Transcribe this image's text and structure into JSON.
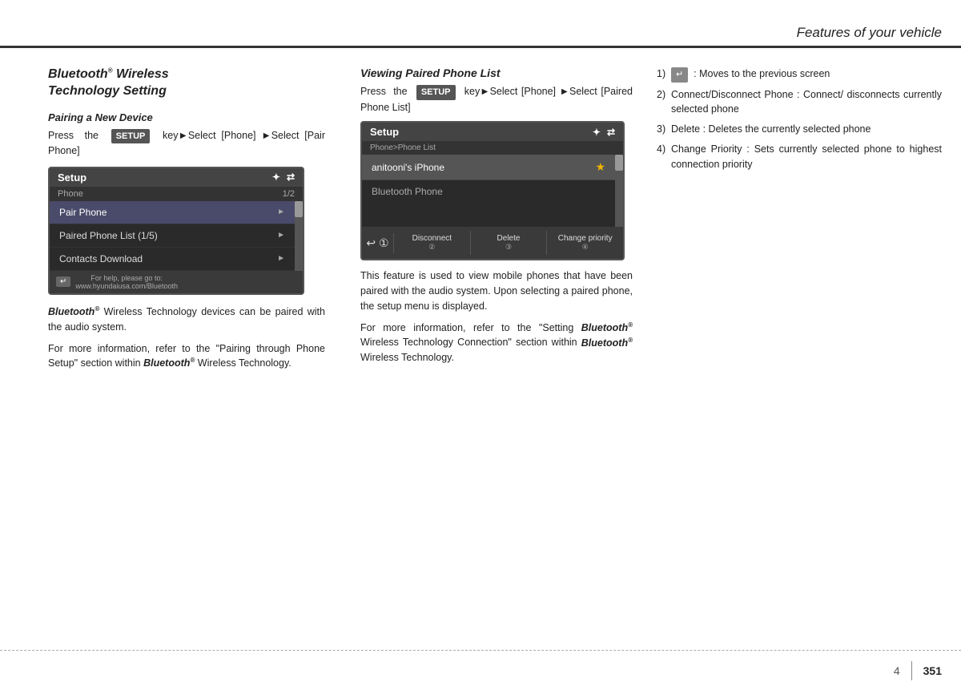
{
  "header": {
    "title": "Features of your vehicle"
  },
  "left_col": {
    "main_title_line1": "Bluetooth",
    "main_title_line2": "® Wireless",
    "main_title_line3": "Technology Setting",
    "pairing_heading": "Pairing a New Device",
    "pairing_text": "Press  the",
    "pairing_badge": "SETUP",
    "pairing_text2": "key▶Select [Phone] ▶Select [Pair Phone]",
    "device_header": "Setup",
    "device_bt_icon": "✦",
    "device_arrow_icon": "⇄",
    "device_subheader": "Phone",
    "device_page": "1/2",
    "menu_item_1": "Pair Phone",
    "menu_item_2": "Paired Phone List (1/5)",
    "menu_item_3": "Contacts Download",
    "device_footer_text": "For help, please go to:",
    "device_footer_url": "www.hyundaiusa.com/Bluetooth",
    "below_text_1": "Bluetooth® Wireless Technology devices can be paired with the audio system.",
    "below_text_2": "For more information, refer to the \"Pairing through Phone Setup\" section within Bluetooth® Wireless Technology."
  },
  "mid_col": {
    "viewing_title": "Viewing Paired Phone List",
    "viewing_text1": "Press  the",
    "viewing_badge": "SETUP",
    "viewing_text2": "key▶Select [Phone] ▶Select [Paired Phone List]",
    "device_header": "Setup",
    "device_bt_icon": "✦",
    "device_arrow_icon": "⇄",
    "device_subheader": "Phone>Phone List",
    "device_phone_name": "anitooni's iPhone",
    "device_phone_type": "Bluetooth Phone",
    "btn_back": "↩",
    "btn_disconnect": "Disconnect",
    "btn_delete": "Delete",
    "btn_change": "Change priority",
    "btn_num_1": "①",
    "btn_num_2": "②",
    "btn_num_3": "③",
    "btn_num_4": "④",
    "body_text": "This feature is used to view mobile phones that have been paired with the audio system. Upon selecting a paired phone, the setup menu is displayed.",
    "ref_text": "For more information, refer to the \"Setting Bluetooth® Wireless Technology Connection\" section within Bluetooth® Wireless Technology."
  },
  "right_col": {
    "items": [
      {
        "num": "1)",
        "icon_label": "back-icon",
        "text": ": Moves to the previous screen"
      },
      {
        "num": "2)",
        "text": "Connect/Disconnect Phone : Connect/ disconnects currently selected phone"
      },
      {
        "num": "3)",
        "text": "Delete : Deletes the currently selected phone"
      },
      {
        "num": "4)",
        "text": "Change Priority : Sets currently selected phone to highest connection priority"
      }
    ]
  },
  "footer": {
    "page_chapter": "4",
    "page_num": "351"
  }
}
